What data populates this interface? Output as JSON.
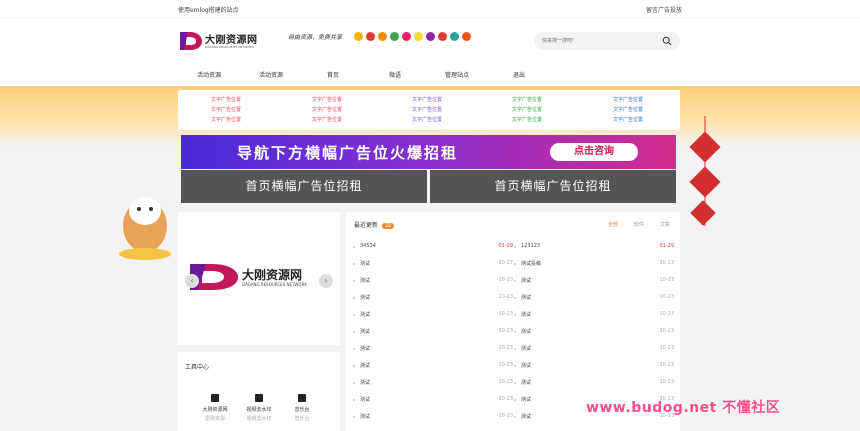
{
  "topbar": {
    "left_text": "使用emlog搭建的站点",
    "right_text": "留言广告投放"
  },
  "header": {
    "logo_name": "大刚资源网",
    "logo_sub": "DAGANG RESOURCES NETWORK",
    "slogan": "自由资源，免费共享",
    "search_placeholder": "快来搜一搜吧!"
  },
  "nav": {
    "items": [
      "活动资源",
      "活动资源",
      "首页",
      "微语",
      "管理站点",
      "退出"
    ]
  },
  "ad_text": {
    "label": "文字广告位置",
    "colors": [
      "#e84a5f",
      "#e84a5f",
      "#7b5cd6",
      "#2fa84f",
      "#2f6fd6"
    ]
  },
  "banner_top": {
    "text": "导航下方横幅广告位火爆招租",
    "button": "点击咨询"
  },
  "banner_home": {
    "left": "首页横幅广告位招租",
    "right": "首页横幅广告位招租"
  },
  "slider": {
    "logo_name": "大刚资源网",
    "logo_sub": "DAGANG RESOURCES NETWORK",
    "prev": "‹",
    "next": "›"
  },
  "tools": {
    "title": "工具中心",
    "items": [
      {
        "label": "大刚资源网",
        "sub": "爱刚资源"
      },
      {
        "label": "视频去水印",
        "sub": "视频去水印"
      },
      {
        "label": "音乐台",
        "sub": "音乐台"
      }
    ]
  },
  "updates": {
    "title": "最近更新",
    "badge": "22",
    "tabs": [
      "全部",
      "软件",
      "文章"
    ],
    "left": [
      {
        "title": "34534",
        "date": "01-29",
        "hot": true
      },
      {
        "title": "测试",
        "date": "10-27",
        "hot": false
      },
      {
        "title": "测试",
        "date": "10-23",
        "hot": false
      },
      {
        "title": "测试",
        "date": "10-23",
        "hot": false
      },
      {
        "title": "测试",
        "date": "10-23",
        "hot": false
      },
      {
        "title": "测试",
        "date": "10-23",
        "hot": false
      },
      {
        "title": "测试",
        "date": "10-23",
        "hot": false
      },
      {
        "title": "测试",
        "date": "10-23",
        "hot": false
      },
      {
        "title": "测试",
        "date": "10-23",
        "hot": false
      },
      {
        "title": "测试",
        "date": "10-23",
        "hot": false
      },
      {
        "title": "测试",
        "date": "10-23",
        "hot": false
      }
    ],
    "right": [
      {
        "title": "123123",
        "date": "01-29",
        "hot": true
      },
      {
        "title": "测试投稿",
        "date": "10-23",
        "hot": false
      },
      {
        "title": "测试",
        "date": "10-23",
        "hot": false
      },
      {
        "title": "测试",
        "date": "10-23",
        "hot": false
      },
      {
        "title": "测试",
        "date": "10-23",
        "hot": false
      },
      {
        "title": "测试",
        "date": "10-23",
        "hot": false
      },
      {
        "title": "测试",
        "date": "10-23",
        "hot": false
      },
      {
        "title": "测试",
        "date": "10-23",
        "hot": false
      },
      {
        "title": "测试",
        "date": "10-23",
        "hot": false
      },
      {
        "title": "测试",
        "date": "10-23",
        "hot": false
      },
      {
        "title": "测试",
        "date": "10-23",
        "hot": false
      }
    ]
  },
  "watermark": "www.budog.net 不懂社区"
}
